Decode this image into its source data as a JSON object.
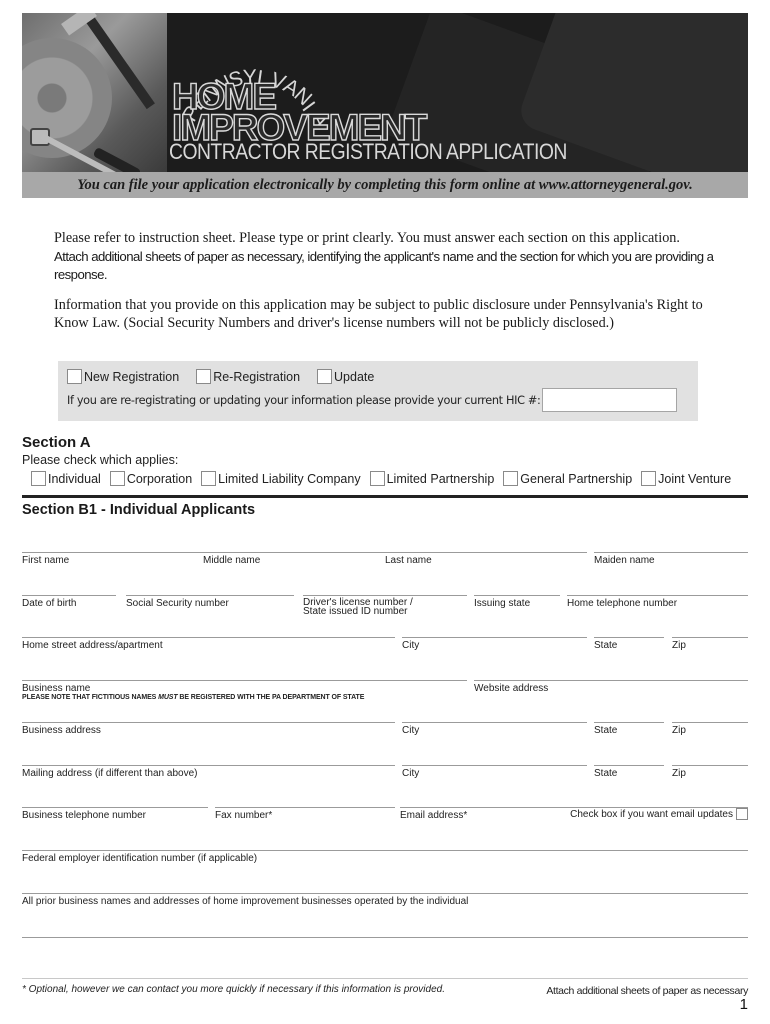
{
  "banner": {
    "state_arc": "PENNSYLVANIA",
    "title_line1": "HOME",
    "title_line2": "IMPROVEMENT",
    "subtitle": "CONTRACTOR REGISTRATION APPLICATION",
    "online_note": "You can file your application electronically by completing this form online at www.attorneygeneral.gov."
  },
  "intro": {
    "line1": "Please refer to instruction sheet.  Please type or print clearly.  You must answer each section on this application.",
    "line2": "Attach additional sheets of paper as necessary, identifying the applicant's name and the section for which you are providing a response.",
    "disclosure": "Information that you provide on this application may be subject to public disclosure under Pennsylvania's Right to Know Law.  (Social Security Numbers and driver's license numbers will not be publicly disclosed.)"
  },
  "registration": {
    "options": [
      {
        "label": "New Registration",
        "checked": false
      },
      {
        "label": "Re-Registration",
        "checked": false
      },
      {
        "label": "Update",
        "checked": false
      }
    ],
    "hic_prompt": "If you are re-registrating or updating your information please provide your current HIC #:",
    "hic_value": ""
  },
  "section_a": {
    "title": "Section A",
    "prompt": "Please check which applies:",
    "options": [
      {
        "label": "Individual",
        "checked": false
      },
      {
        "label": "Corporation",
        "checked": false
      },
      {
        "label": "Limited Liability Company",
        "checked": false
      },
      {
        "label": "Limited Partnership",
        "checked": false
      },
      {
        "label": "General Partnership",
        "checked": false
      },
      {
        "label": "Joint Venture",
        "checked": false
      }
    ]
  },
  "section_b1": {
    "title": "Section B1 - Individual Applicants",
    "fields": {
      "first_name": "First name",
      "middle_name": "Middle name",
      "last_name": "Last name",
      "maiden_name": "Maiden name",
      "date_of_birth": "Date of birth",
      "ssn": "Social Security number",
      "drivers_license_1": "Driver's license number /",
      "drivers_license_2": "State issued ID number",
      "issuing_state": "Issuing state",
      "home_phone": "Home telephone number",
      "home_address": "Home street address/apartment",
      "home_city": "City",
      "home_state": "State",
      "home_zip": "Zip",
      "business_name": "Business name",
      "fictitious_note_pre": "PLEASE NOTE THAT FICTITIOUS NAMES ",
      "fictitious_note_em": "MUST",
      "fictitious_note_post": " BE REGISTERED WITH THE PA DEPARTMENT OF STATE",
      "website": "Website address",
      "business_address": "Business address",
      "business_city": "City",
      "business_state": "State",
      "business_zip": "Zip",
      "mailing_address": "Mailing address (if different than above)",
      "mailing_city": "City",
      "mailing_state": "State",
      "mailing_zip": "Zip",
      "business_phone": "Business telephone number",
      "fax": "Fax number*",
      "email": "Email address*",
      "email_updates": "Check box if you want email updates",
      "fein": "Federal employer identification number (if applicable)",
      "prior_businesses": "All prior business names and addresses of home improvement businesses operated by the individual"
    },
    "email_updates_checked": false
  },
  "footer": {
    "footnote": "* Optional, however we can contact you more quickly if necessary if this information is provided.",
    "attach_note": "Attach additional sheets of paper as necessary",
    "page_number": "1"
  }
}
